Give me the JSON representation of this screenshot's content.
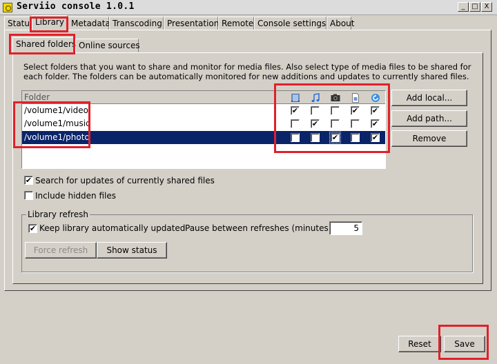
{
  "window": {
    "title": "Serviio console 1.0.1",
    "minimize": "_",
    "maximize": "□",
    "close": "X"
  },
  "main_tabs": [
    "Status",
    "Library",
    "Metadata",
    "Transcoding",
    "Presentation",
    "Remote",
    "Console settings",
    "About"
  ],
  "active_main_tab": "Library",
  "sub_tabs": [
    "Shared folders",
    "Online sources"
  ],
  "active_sub_tab": "Shared folders",
  "description": "Select folders that you want to share and monitor for media files. Also select type of media files to be shared for each folder. The folders can be automatically monitored for new additions and updates to currently shared files.",
  "folder_table": {
    "header": "Folder",
    "columns": [
      "video-icon",
      "music-icon",
      "image-icon",
      "metadata-icon",
      "refresh-icon"
    ],
    "rows": [
      {
        "path": "/volume1/video",
        "checks": [
          true,
          false,
          false,
          true,
          true
        ],
        "selected": false
      },
      {
        "path": "/volume1/music",
        "checks": [
          false,
          true,
          false,
          false,
          true
        ],
        "selected": false
      },
      {
        "path": "/volume1/photo",
        "checks": [
          false,
          false,
          true,
          false,
          true
        ],
        "selected": true
      }
    ]
  },
  "buttons": {
    "add_local": "Add local...",
    "add_path": "Add path...",
    "remove": "Remove",
    "force_refresh": "Force refresh",
    "show_status": "Show status",
    "reset": "Reset",
    "save": "Save"
  },
  "options": {
    "search_updates": {
      "label": "Search for updates of currently shared files",
      "checked": true
    },
    "include_hidden": {
      "label": "Include hidden files",
      "checked": false
    }
  },
  "library_refresh": {
    "title": "Library refresh",
    "keep_updated": {
      "label": "Keep library automatically updated",
      "checked": true
    },
    "pause_label": "Pause between refreshes (minutes):",
    "pause_value": "5"
  },
  "colors": {
    "highlight": "#e0202a",
    "selection": "#0a246a",
    "face": "#d4d0c8"
  }
}
